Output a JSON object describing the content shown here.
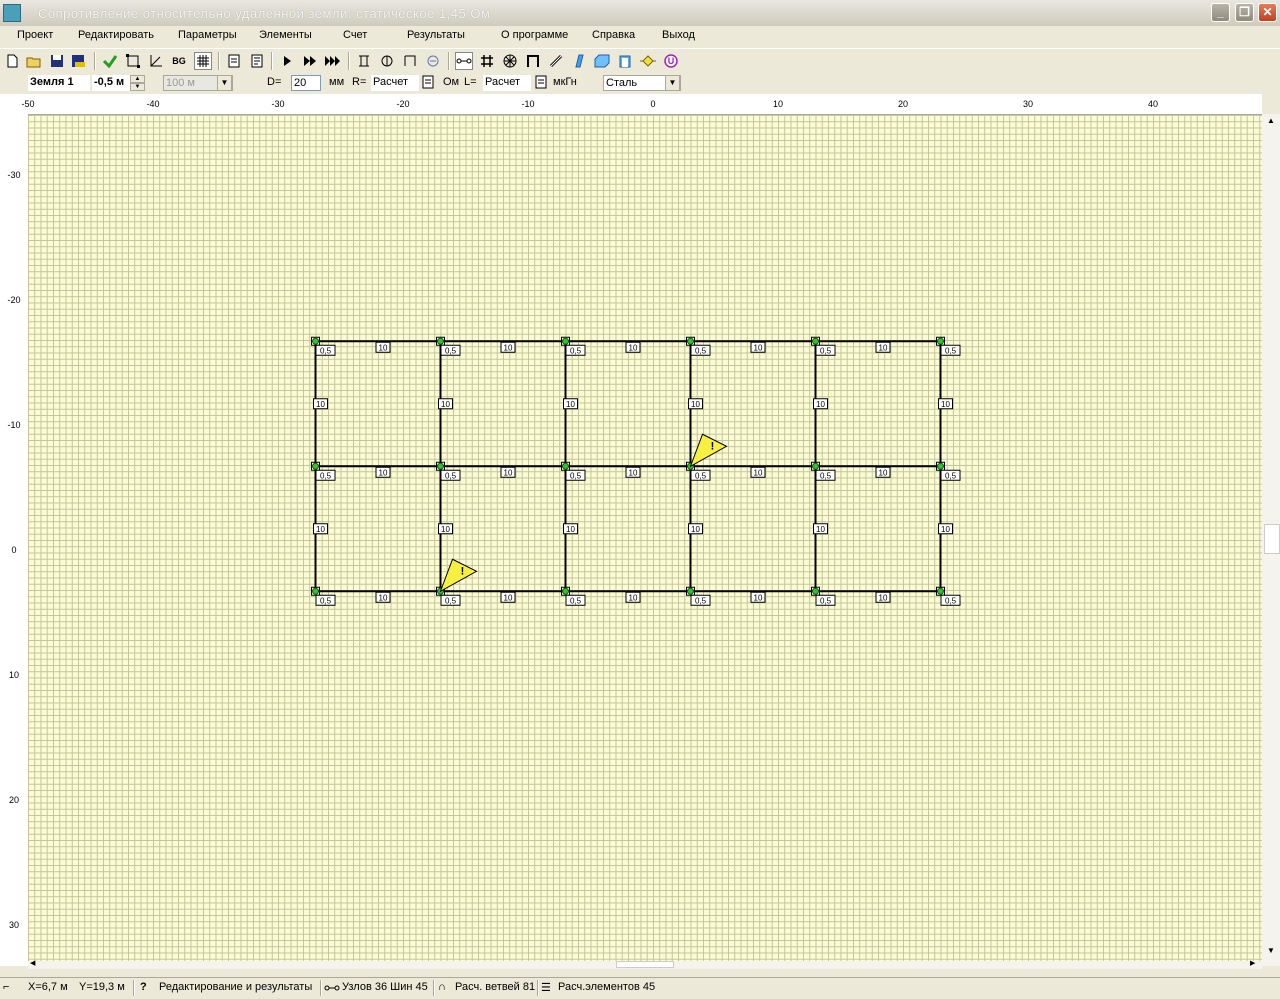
{
  "window": {
    "title": "Сопротивление относительно удаленной земли:     статическое 1,45 Ом",
    "minimize_glyph": "_",
    "maximize_glyph": "❐",
    "close_glyph": "✕"
  },
  "menu": [
    "Проект",
    "Редактировать",
    "Параметры",
    "Элементы",
    "Счет",
    "Результаты",
    "О программе",
    "Справка",
    "Выход"
  ],
  "toolbar_icons": [
    "new-icon",
    "open-icon",
    "save-icon",
    "save-as-icon",
    "add-node-icon",
    "select-frame-icon",
    "axes-icon",
    "bg-icon",
    "grid-icon",
    "page-icon",
    "page-text-icon",
    "run-icon",
    "run-fast-icon",
    "run-all-icon",
    "tool-1-icon",
    "tool-2-icon",
    "tool-3-icon",
    "tool-4-icon",
    "connect-icon",
    "mesh-icon",
    "snowflake-icon",
    "arch-icon",
    "cable-icon",
    "plane-icon",
    "box-icon",
    "cylinder-icon",
    "node-icon",
    "u-icon"
  ],
  "toolbar": {
    "bg_label": "BG"
  },
  "props": {
    "layer": "Земля 1",
    "depth": "-0,5 м",
    "length_combo": "100 м",
    "d_label": "D=",
    "d_value": "20",
    "d_unit": "мм",
    "r_label": "R=",
    "r_value": "Расчет",
    "r_unit": "Ом",
    "l_label": "L=",
    "l_value": "Расчет",
    "l_unit": "мкГн",
    "material": "Сталь"
  },
  "ruler": {
    "h_labels": [
      "-50",
      "-40",
      "-30",
      "-20",
      "-10",
      "0",
      "10",
      "20",
      "30",
      "40"
    ],
    "v_labels": [
      "-30",
      "-20",
      "-10",
      "0",
      "10",
      "20",
      "30"
    ]
  },
  "grid_model": {
    "x_nodes": [
      -27,
      -17,
      -7,
      3,
      13,
      23
    ],
    "y_nodes": [
      -16.7,
      -6.7,
      3.3
    ],
    "segment_length_label": "10",
    "node_depth_label": "0,5",
    "nodes_total": 18,
    "marker_label": "!",
    "markers": [
      [
        3,
        -6.7
      ],
      [
        -17,
        3.3
      ]
    ]
  },
  "status": {
    "x": "X=6,7 м",
    "y": "Y=19,3 м",
    "help": "?",
    "mode": "Редактирование и результаты",
    "nodes": "Узлов 36 Шин 45",
    "branches": "Расч. ветвей 81",
    "elements": "Расч.элементов 45"
  }
}
